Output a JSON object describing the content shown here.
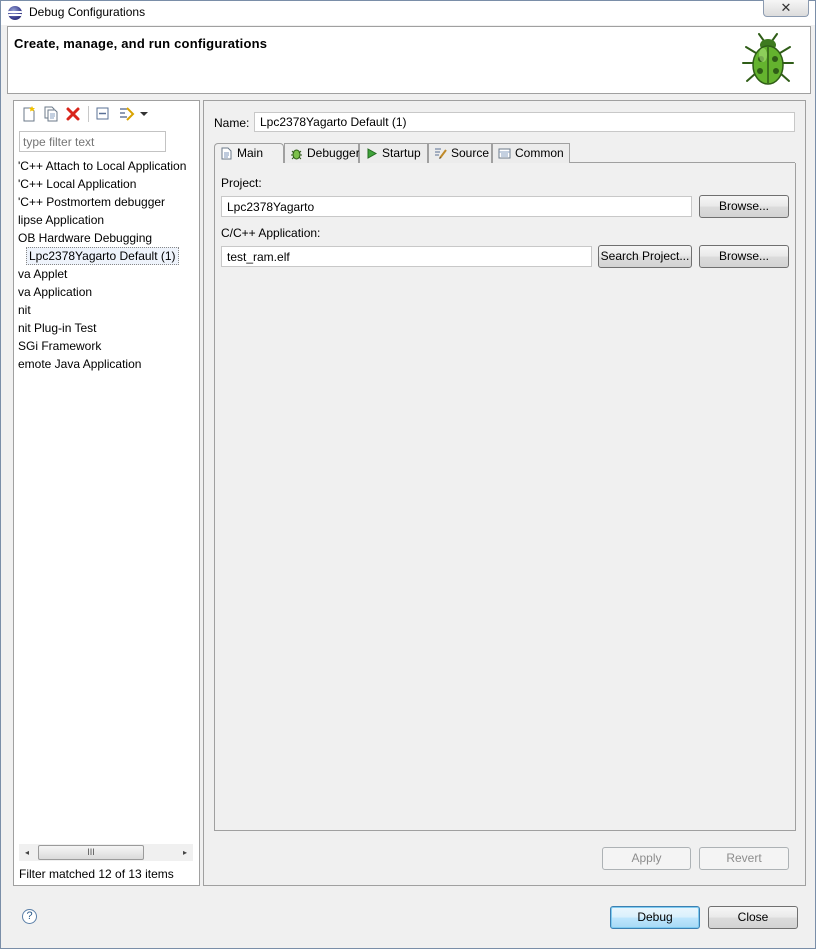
{
  "window": {
    "title": "Debug Configurations",
    "close_glyph": "✕"
  },
  "header": {
    "heading": "Create, manage, and run configurations",
    "icon": "bug-icon"
  },
  "left": {
    "toolbar": [
      "new-config-icon",
      "duplicate-icon",
      "delete-icon",
      "collapse-all-icon",
      "filter-icon",
      "dropdown-arrow-icon"
    ],
    "filter_placeholder": "type filter text",
    "items": [
      {
        "label": "'C++ Attach to Local Application"
      },
      {
        "label": "'C++ Local Application"
      },
      {
        "label": "'C++ Postmortem debugger"
      },
      {
        "label": "lipse Application"
      },
      {
        "label": "OB Hardware Debugging"
      },
      {
        "label": "Lpc2378Yagarto Default (1)",
        "selected": true
      },
      {
        "label": "va Applet"
      },
      {
        "label": "va Application"
      },
      {
        "label": "nit"
      },
      {
        "label": "nit Plug-in Test"
      },
      {
        "label": "SGi Framework"
      },
      {
        "label": "emote Java Application"
      }
    ],
    "scroll_left": "◂",
    "scroll_right": "▸",
    "scroll_thumb": "III",
    "filter_status": "Filter matched 12 of 13 items"
  },
  "right": {
    "name_label": "Name:",
    "name_value": "Lpc2378Yagarto Default (1)",
    "tabs": [
      {
        "label": "Main",
        "icon": "main-tab-icon",
        "active": true
      },
      {
        "label": "Debugger",
        "icon": "debugger-tab-icon"
      },
      {
        "label": "Startup",
        "icon": "startup-tab-icon"
      },
      {
        "label": "Source",
        "icon": "source-tab-icon"
      },
      {
        "label": "Common",
        "icon": "common-tab-icon"
      }
    ],
    "project_label": "Project:",
    "project_value": "Lpc2378Yagarto",
    "browse_label": "Browse...",
    "app_label": "C/C++ Application:",
    "app_value": "test_ram.elf",
    "search_project_label": "Search Project...",
    "apply_label": "Apply",
    "revert_label": "Revert"
  },
  "footer": {
    "help_glyph": "?",
    "debug_label": "Debug",
    "close_label": "Close"
  }
}
